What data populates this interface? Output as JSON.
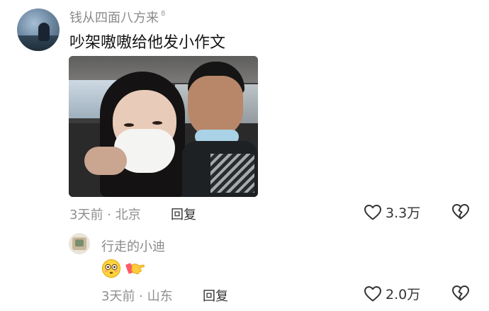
{
  "comment": {
    "author": "钱从四面八方来",
    "author_badge": "8",
    "text": "吵架嗷嗷给他发小作文",
    "time_location": "3天前 · 北京",
    "reply_label": "回复",
    "likes": "3.3万",
    "like_icon": "heart-outline-icon",
    "dislike_icon": "broken-heart-icon"
  },
  "reply": {
    "author": "行走的小迪",
    "emojis": [
      "flushed-face-emoji",
      "pointing-hand-emoji"
    ],
    "time_location": "3天前 · 山东",
    "reply_label": "回复",
    "likes": "2.0万",
    "like_icon": "heart-outline-icon",
    "dislike_icon": "broken-heart-icon"
  },
  "colors": {
    "secondary_text": "#8a8a8a",
    "primary_text": "#151515",
    "icon": "#333333"
  }
}
